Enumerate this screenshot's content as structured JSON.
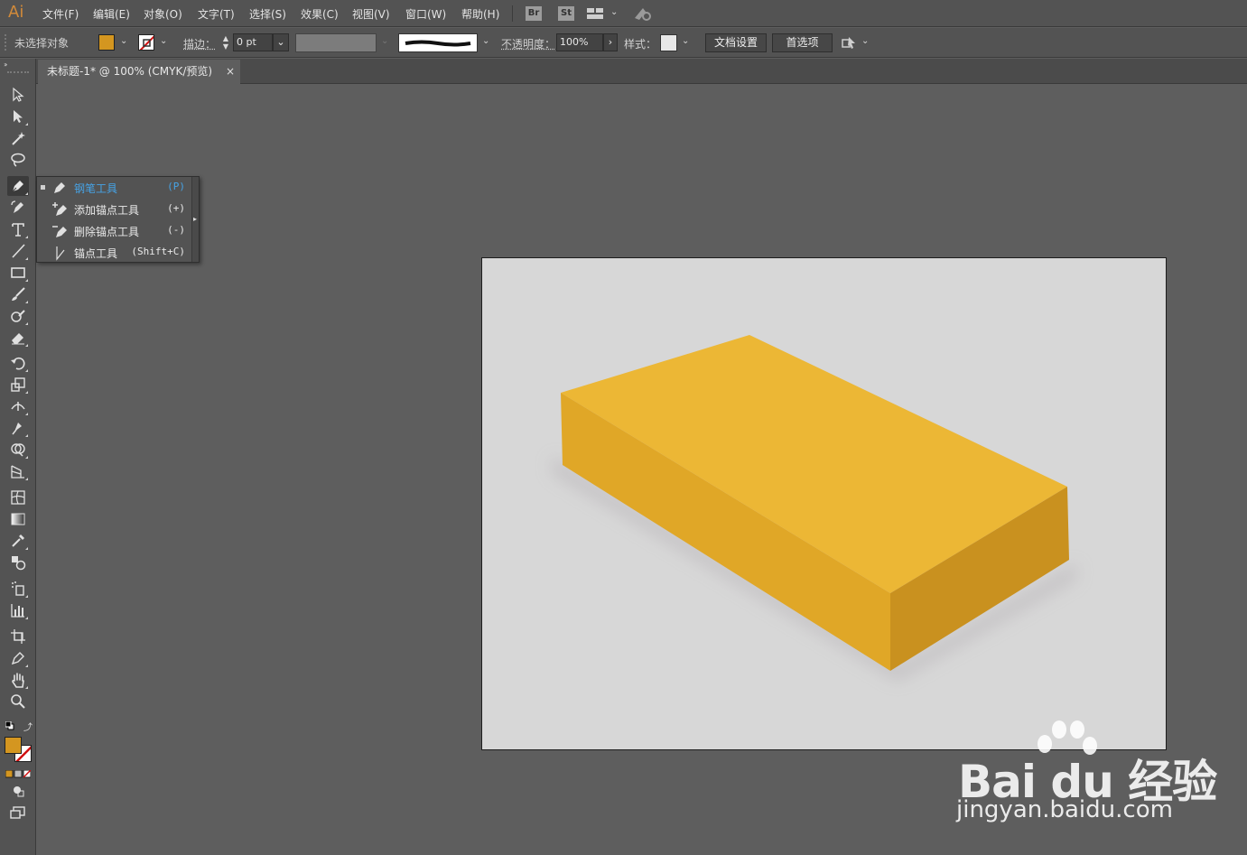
{
  "app": {
    "logo": "Ai",
    "menus": [
      "文件(F)",
      "编辑(E)",
      "对象(O)",
      "文字(T)",
      "选择(S)",
      "效果(C)",
      "视图(V)",
      "窗口(W)",
      "帮助(H)"
    ],
    "bridge": "Br",
    "stock": "St"
  },
  "control": {
    "selection_status": "未选择对象",
    "fill_color": "#d49620",
    "stroke_label": "描边：",
    "stroke_value": "0 pt",
    "opacity_label": "不透明度：",
    "opacity_value": "100%",
    "style_label": "样式：",
    "doc_setup": "文档设置",
    "preferences": "首选项"
  },
  "document": {
    "tab_title": "未标题-1* @ 100% (CMYK/预览)",
    "close": "×"
  },
  "flyout": {
    "items": [
      {
        "label": "钢笔工具",
        "shortcut": "(P)",
        "selected": true
      },
      {
        "label": "添加锚点工具",
        "shortcut": "(+)"
      },
      {
        "label": "删除锚点工具",
        "shortcut": "(-)"
      },
      {
        "label": "锚点工具",
        "shortcut": "(Shift+C)"
      }
    ]
  },
  "artwork": {
    "top_color": "#ecb735",
    "left_color": "#e0a727",
    "right_color": "#c9911f",
    "background": "#d7d7d7"
  },
  "watermark": {
    "brand": "Bai du 经验",
    "url": "jingyan.baidu.com"
  }
}
